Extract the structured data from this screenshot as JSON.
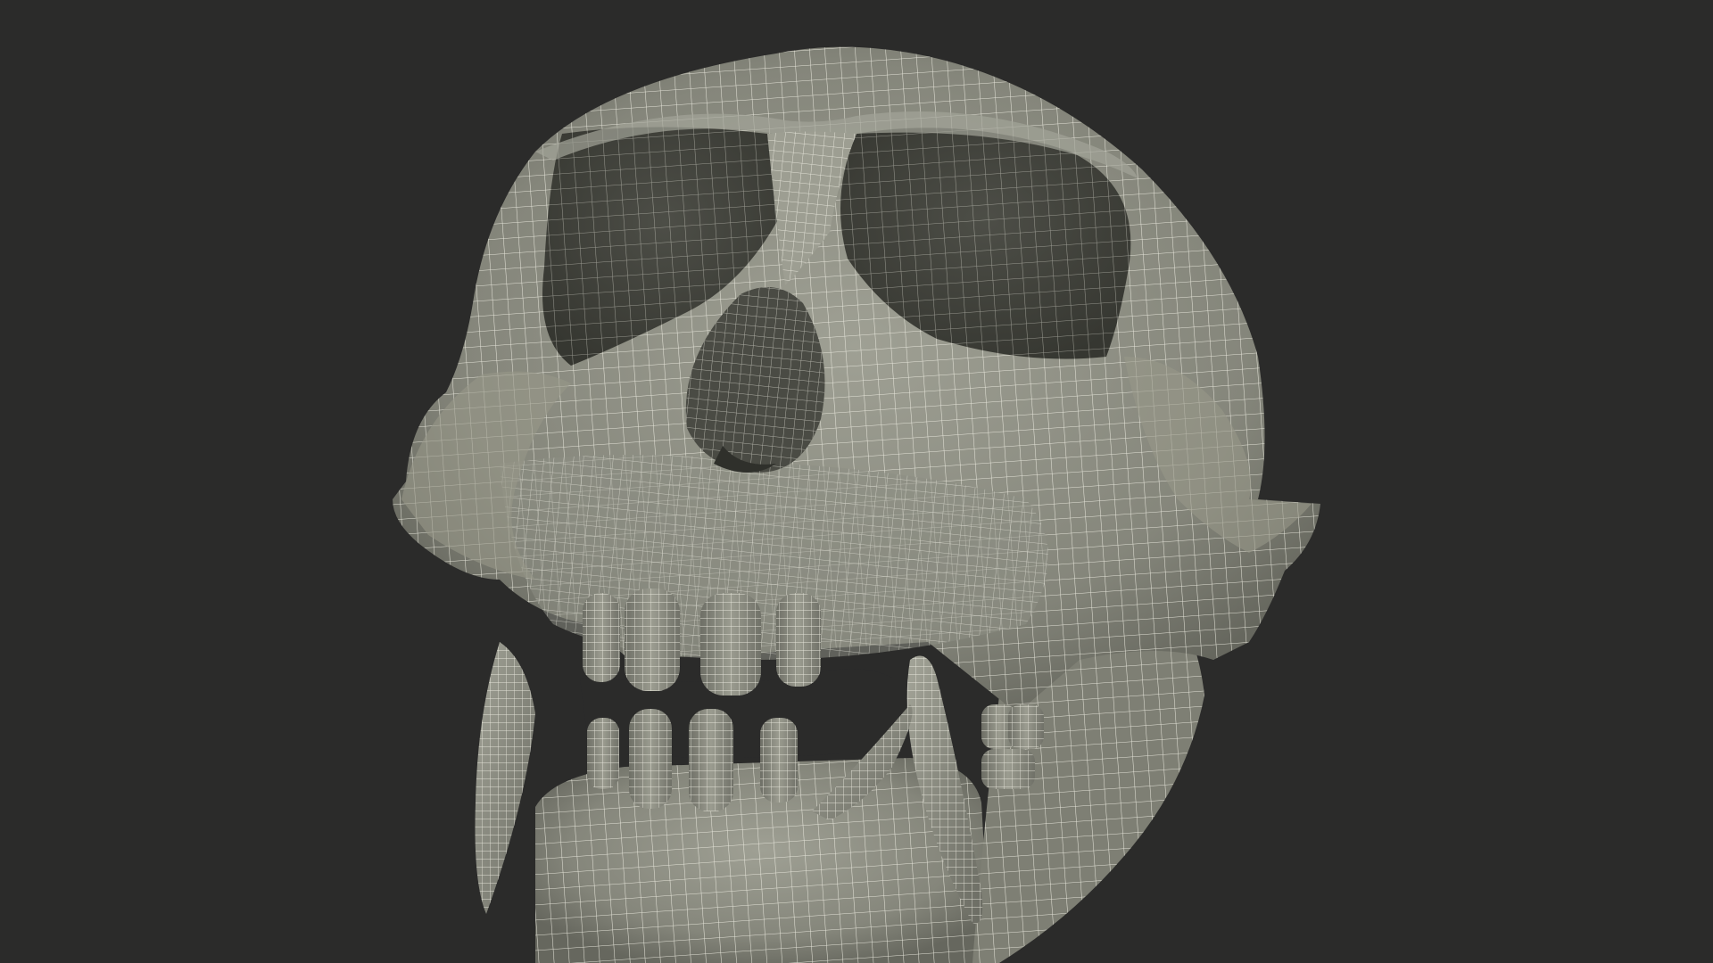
{
  "scene": {
    "subject": "skull-wireframe-render",
    "colors": {
      "background": "#2b2b2a",
      "bone": "#8a8b7f",
      "bone_light": "#a3a498",
      "bone_shadow": "#5c5d54",
      "cavity": "#3e3f39",
      "wire": "#eeede2"
    }
  }
}
